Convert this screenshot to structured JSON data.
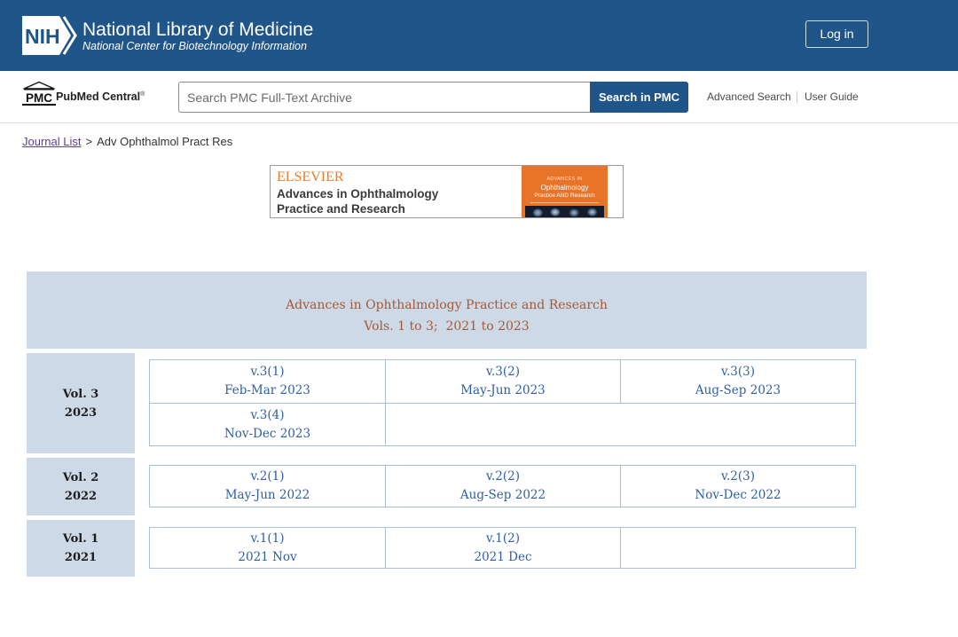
{
  "theme": {
    "brand": "#20558a",
    "panel": "#cdd9e6",
    "title_text": "#a55a35",
    "issue_link": "#2e5ea6",
    "visited_link": "#5c3f97",
    "publisher_orange": "#ee7b25",
    "cover_orange": "#e8742a",
    "table_border": "#a9c0dc"
  },
  "header": {
    "logo_text": "NIH",
    "org_title": "National Library of Medicine",
    "org_subtitle": "National Center for Biotechnology Information",
    "login_label": "Log in"
  },
  "search_bar": {
    "pmc_logo_text": "PMC",
    "pmc_name": "PubMed Central",
    "pmc_trademark": "®",
    "placeholder": "Search PMC Full-Text Archive",
    "value": "",
    "button_label": "Search in PMC",
    "links": [
      {
        "label": "Advanced Search"
      },
      {
        "label": "User Guide"
      }
    ]
  },
  "breadcrumb": {
    "link_label": "Journal List",
    "separator": ">",
    "current": "Adv Ophthalmol Pract Res"
  },
  "banner": {
    "publisher": "ELSEVIER",
    "journal_line1": "Advances in Ophthalmology",
    "journal_line2": "Practice and Research",
    "cover_line1": "ADVANCES IN",
    "cover_line2": "Ophthalmology",
    "cover_line3": "Practice AND Research"
  },
  "journal": {
    "title": "Advances in Ophthalmology Practice and Research",
    "range": "Vols. 1 to 3;  2021 to 2023"
  },
  "volumes": [
    {
      "label": "Vol. 3",
      "year": "2023",
      "issues": [
        {
          "number": "v.3(1)",
          "date": "Feb-Mar 2023"
        },
        {
          "number": "v.3(2)",
          "date": "May-Jun 2023"
        },
        {
          "number": "v.3(3)",
          "date": "Aug-Sep 2023"
        },
        {
          "number": "v.3(4)",
          "date": "Nov-Dec 2023"
        }
      ]
    },
    {
      "label": "Vol. 2",
      "year": "2022",
      "issues": [
        {
          "number": "v.2(1)",
          "date": "May-Jun 2022"
        },
        {
          "number": "v.2(2)",
          "date": "Aug-Sep 2022"
        },
        {
          "number": "v.2(3)",
          "date": "Nov-Dec 2022"
        }
      ]
    },
    {
      "label": "Vol. 1",
      "year": "2021",
      "issues": [
        {
          "number": "v.1(1)",
          "date": "2021 Nov"
        },
        {
          "number": "v.1(2)",
          "date": "2021 Dec"
        }
      ]
    }
  ]
}
